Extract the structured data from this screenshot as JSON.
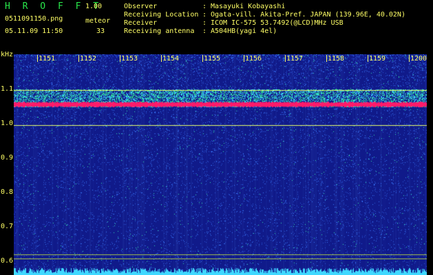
{
  "header": {
    "title": "H R O F F T",
    "version": "1.00",
    "filename": "0511091150.png",
    "mode": "meteor",
    "datetime": "05.11.09 11:50",
    "count": "33"
  },
  "station": {
    "rows": [
      {
        "label": "Observer",
        "value": "Masayuki Kobayashi"
      },
      {
        "label": "Receiving Location",
        "value": "Ogata-vill. Akita-Pref. JAPAN (139.96E, 40.02N)"
      },
      {
        "label": "Receiver",
        "value": "ICOM IC-575 53.7492(@LCD)MHz USB"
      },
      {
        "label": "Receiving antenna",
        "value": "A504HB(yagi 4el)"
      }
    ]
  },
  "spectrogram": {
    "y_unit": "kHz",
    "y_ticks": [
      "1.1",
      "1.0",
      "0.9",
      "0.8",
      "0.7",
      "0.6"
    ],
    "x_ticks": [
      "1151",
      "1152",
      "1153",
      "1154",
      "1155",
      "1156",
      "1157",
      "1158",
      "1159",
      "1200"
    ],
    "colors": {
      "background": "#101a8a",
      "noise": "#2f6fff",
      "signal": "#ff1a6a",
      "line": "#e7ff6a"
    }
  }
}
